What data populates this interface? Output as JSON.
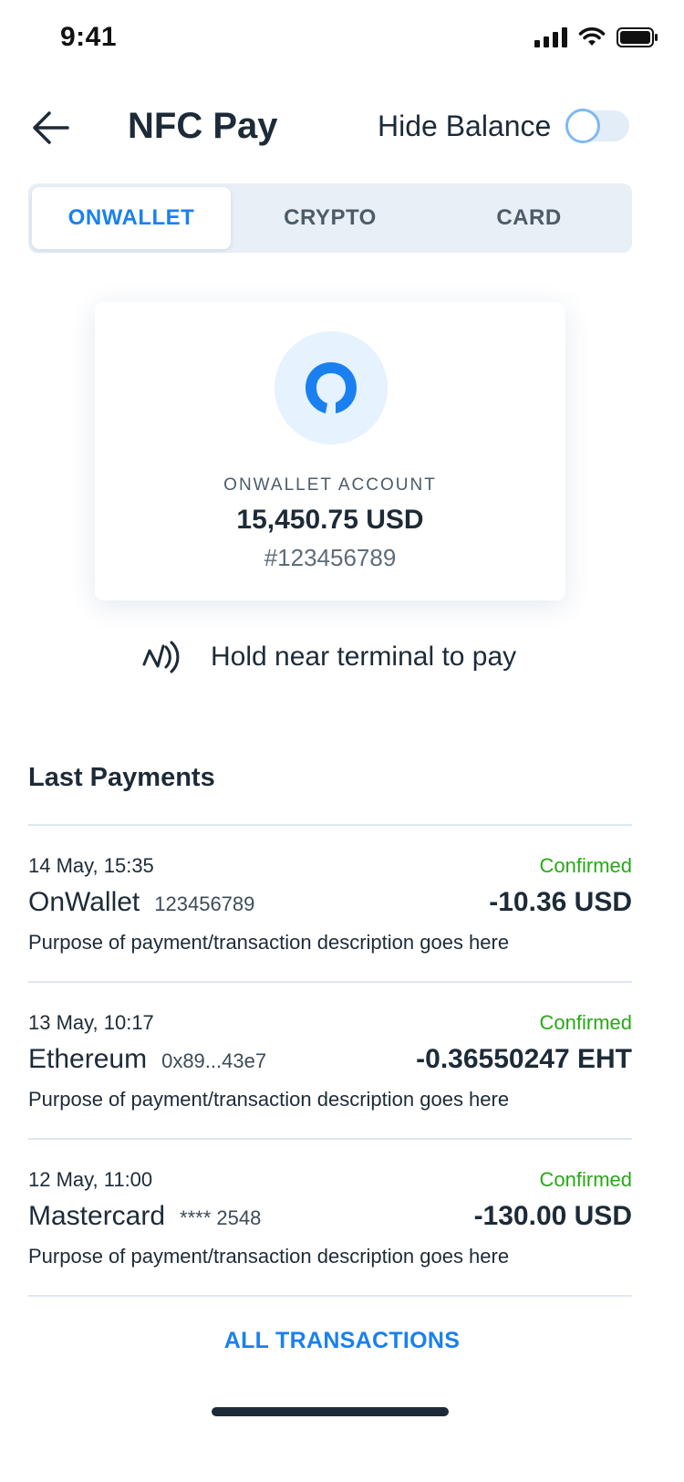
{
  "status_bar": {
    "time": "9:41",
    "icons": [
      "signal-icon",
      "wifi-icon",
      "battery-icon"
    ]
  },
  "header": {
    "back_icon": "arrow-left-icon",
    "title": "NFC Pay",
    "hide_balance_label": "Hide Balance",
    "hide_balance_on": false
  },
  "tabs": [
    {
      "label": "ONWALLET",
      "active": true
    },
    {
      "label": "CRYPTO",
      "active": false
    },
    {
      "label": "CARD",
      "active": false
    }
  ],
  "account": {
    "label": "ONWALLET ACCOUNT",
    "balance": "15,450.75 USD",
    "number": "#123456789",
    "logo_icon": "onwallet-logo-icon"
  },
  "nfc": {
    "icon": "nfc-icon",
    "text": "Hold near terminal to pay"
  },
  "payments": {
    "title": "Last Payments",
    "items": [
      {
        "date": "14 May, 15:35",
        "status": "Confirmed",
        "merchant": "OnWallet",
        "ref": "123456789",
        "amount": "-10.36 USD",
        "description": "Purpose of payment/transaction description goes here"
      },
      {
        "date": "13 May, 10:17",
        "status": "Confirmed",
        "merchant": "Ethereum",
        "ref": "0x89...43e7",
        "amount": "-0.36550247 EHT",
        "description": "Purpose of payment/transaction description goes here"
      },
      {
        "date": "12 May, 11:00",
        "status": "Confirmed",
        "merchant": "Mastercard",
        "ref": "**** 2548",
        "amount": "-130.00 USD",
        "description": "Purpose of payment/transaction description goes here"
      }
    ],
    "all_label": "ALL TRANSACTIONS"
  },
  "colors": {
    "accent": "#1a80f0",
    "confirmed": "#28a818",
    "text": "#1d2b38",
    "tab_bg": "#e9eff6"
  }
}
